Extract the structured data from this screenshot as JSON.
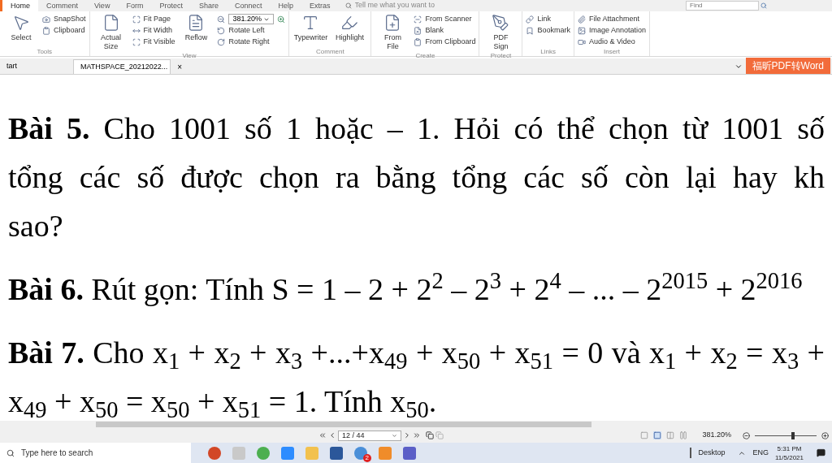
{
  "menu_tabs": [
    {
      "label": "Home",
      "selected": true
    },
    {
      "label": "Comment",
      "selected": false
    },
    {
      "label": "View",
      "selected": false
    },
    {
      "label": "Form",
      "selected": false
    },
    {
      "label": "Protect",
      "selected": false
    },
    {
      "label": "Share",
      "selected": false
    },
    {
      "label": "Connect",
      "selected": false
    },
    {
      "label": "Help",
      "selected": false
    },
    {
      "label": "Extras",
      "selected": false
    }
  ],
  "tell_me": {
    "placeholder": "Tell me what you want to"
  },
  "find": {
    "placeholder": "Find"
  },
  "ribbon": [
    {
      "title": "Tools",
      "columns": [
        [
          {
            "kind": "large",
            "label": "Select"
          }
        ],
        [
          {
            "kind": "small",
            "label": "SnapShot"
          },
          {
            "kind": "small",
            "label": "Clipboard"
          }
        ]
      ]
    },
    {
      "title": "View",
      "columns": [
        [
          {
            "kind": "large",
            "label": "Actual Size"
          }
        ],
        [
          {
            "kind": "small",
            "label": "Fit Page"
          },
          {
            "kind": "small",
            "label": "Fit Width"
          },
          {
            "kind": "small",
            "label": "Fit Visible"
          }
        ],
        [
          {
            "kind": "large",
            "label": "Reflow"
          }
        ],
        [
          {
            "kind": "combo",
            "label": "381.20%"
          },
          {
            "kind": "small",
            "label": "Rotate Left"
          },
          {
            "kind": "small",
            "label": "Rotate Right"
          }
        ]
      ]
    },
    {
      "title": "Comment",
      "columns": [
        [
          {
            "kind": "large",
            "label": "Typewriter"
          }
        ],
        [
          {
            "kind": "large",
            "label": "Highlight"
          }
        ]
      ]
    },
    {
      "title": "Create",
      "columns": [
        [
          {
            "kind": "large",
            "label": "From File"
          }
        ],
        [
          {
            "kind": "small",
            "label": "From Scanner"
          },
          {
            "kind": "small",
            "label": "Blank"
          },
          {
            "kind": "small",
            "label": "From Clipboard"
          }
        ]
      ]
    },
    {
      "title": "Protect",
      "columns": [
        [
          {
            "kind": "large",
            "label": "PDF Sign"
          }
        ]
      ]
    },
    {
      "title": "Links",
      "columns": [
        [
          {
            "kind": "small",
            "label": "Link"
          },
          {
            "kind": "small",
            "label": "Bookmark"
          }
        ]
      ]
    },
    {
      "title": "Insert",
      "columns": [
        [
          {
            "kind": "small",
            "label": "File Attachment"
          },
          {
            "kind": "small",
            "label": "Image Annotation"
          },
          {
            "kind": "small",
            "label": "Audio & Video"
          }
        ]
      ]
    }
  ],
  "doc_tabs": [
    {
      "label": "tart",
      "selected": false
    },
    {
      "label": "MATHSPACE_20212022...",
      "selected": true,
      "close": "×"
    }
  ],
  "convert_button": "福昕PDF转Word",
  "document": [
    {
      "lines": [
        "**Bài 5.** Cho 1001 số 1 hoặc – 1. Hỏi có thể chọn từ 1001 số",
        "tổng các số được chọn ra bằng tổng các số còn lại hay kh",
        "sao?"
      ]
    },
    {
      "lines": [
        "**Bài 6.** Rút gọn: Tính S = 1 – 2 + 2$^{2}$ – 2$^{3}$ + 2$^{4}$ – ... – 2$^{2015}$ + 2$^{2016}$"
      ]
    },
    {
      "lines": [
        "**Bài 7.** Cho x$_{1}$ + x$_{2}$ + x$_{3}$ +...+x$_{49}$ + x$_{50}$ + x$_{51}$ = 0 và x$_{1}$ + x$_{2}$ = x$_{3}$ +",
        "x$_{49}$  + x$_{50}$ = x$_{50}$ + x$_{51}$ = 1. Tính x$_{50}$."
      ]
    }
  ],
  "nav": {
    "page": "12 / 44",
    "zoom": "381.20%"
  },
  "zoom_slider": {
    "level": 0.62
  },
  "taskbar": {
    "search": {
      "placeholder": "Type here to search"
    },
    "apps": [
      {
        "kind": "powerpoint"
      },
      {
        "kind": "tiles"
      },
      {
        "kind": "chrome"
      },
      {
        "kind": "zoom"
      },
      {
        "kind": "folder"
      },
      {
        "kind": "word"
      },
      {
        "kind": "chat",
        "badge": "2"
      },
      {
        "kind": "foxit"
      },
      {
        "kind": "teams"
      }
    ],
    "desktop": "Desktop",
    "lang": "ENG",
    "time": "5:31 PM",
    "date": "11/5/2021"
  }
}
